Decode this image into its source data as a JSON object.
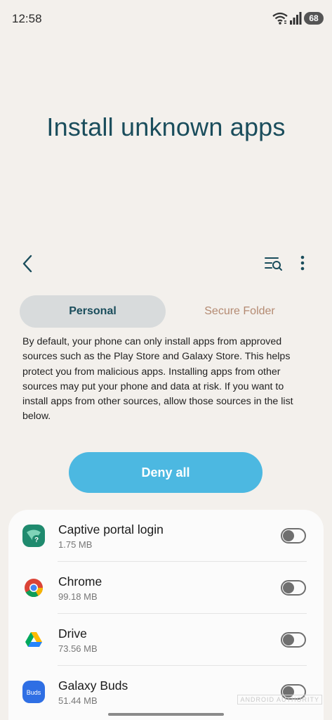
{
  "status_bar": {
    "time": "12:58",
    "battery": "68"
  },
  "header": {
    "title": "Install unknown apps"
  },
  "tabs": {
    "personal": "Personal",
    "secure_folder": "Secure Folder"
  },
  "description": "By default, your phone can only install apps from approved sources such as the Play Store and Galaxy Store. This helps protect you from malicious apps. Installing apps from other sources may put your phone and data at risk. If you want to install apps from other sources, allow those sources in the list below.",
  "deny_all_label": "Deny all",
  "apps": [
    {
      "name": "Captive portal login",
      "size": "1.75 MB",
      "icon": "captive-portal-icon",
      "toggle_on": false
    },
    {
      "name": "Chrome",
      "size": "99.18 MB",
      "icon": "chrome-icon",
      "toggle_on": false
    },
    {
      "name": "Drive",
      "size": "73.56 MB",
      "icon": "drive-icon",
      "toggle_on": false
    },
    {
      "name": "Galaxy Buds",
      "size": "51.44 MB",
      "icon": "galaxy-buds-icon",
      "icon_text": "Buds",
      "toggle_on": false
    }
  ],
  "watermark": "ANDROID AUTHORITY",
  "colors": {
    "background": "#f3f0ec",
    "title": "#1a4d5c",
    "accent_button": "#4cb8e1",
    "tab_selected_bg": "#d8dbdc",
    "tab_unselected_text": "#b48a72"
  }
}
